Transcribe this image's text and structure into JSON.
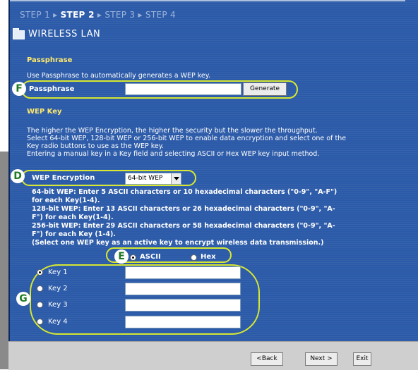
{
  "wizard": {
    "step1": "STEP 1",
    "sep1": "▸",
    "step2": "STEP 2",
    "sep2": "▸",
    "step3": "STEP 3",
    "sep3": "▸",
    "step4": "STEP 4",
    "active_step": "STEP 2"
  },
  "page": {
    "title": "WIRELESS LAN",
    "icon": "folder-icon"
  },
  "passphrase_section": {
    "title": "Passphrase",
    "description": "Use Passphrase to automatically generates a WEP key.",
    "label": "Passphrase",
    "value": "",
    "generate_label": "Generate",
    "callout": "F"
  },
  "wep_section": {
    "title": "WEP Key",
    "desc1": "The higher the WEP Encryption, the higher the security but the slower the throughput.",
    "desc2": "Select 64-bit WEP, 128-bit WEP or 256-bit WEP to enable data encryption and select one of the",
    "desc3": "Key radio buttons to use as the WEP key.",
    "desc4": "Entering a manual key in a Key field and selecting ASCII or Hex WEP key input method.",
    "encryption_label": "WEP Encryption",
    "encryption_value": "64-bit WEP",
    "callout_d": "D",
    "info1": "64-bit WEP: Enter 5 ASCII characters or 10 hexadecimal characters (\"0-9\", \"A-F\")",
    "info2": "for each Key(1-4).",
    "info3": "128-bit WEP: Enter 13 ASCII characters or 26 hexadecimal characters (\"0-9\", \"A-",
    "info4": "F\") for each Key(1-4).",
    "info5": "256-bit WEP: Enter 29 ASCII characters or 58 hexadecimal characters (\"0-9\", \"A-",
    "info6": "F\") for each Key (1-4).",
    "info7": "(Select one WEP key as an active key to encrypt wireless data transmission.)",
    "callout_e": "E",
    "ascii_label": "ASCII",
    "hex_label": "Hex",
    "input_method": "ASCII",
    "callout_g": "G",
    "keys": [
      {
        "label": "Key 1",
        "value": "",
        "selected": true
      },
      {
        "label": "Key 2",
        "value": "",
        "selected": false
      },
      {
        "label": "Key 3",
        "value": "",
        "selected": false
      },
      {
        "label": "Key 4",
        "value": "",
        "selected": false
      }
    ]
  },
  "footer": {
    "back_label": "<Back",
    "next_label": "Next >",
    "exit_label": "Exit"
  },
  "colors": {
    "background": "#2b5aa8",
    "section_title": "#ffe96b",
    "callout": "#d8e830",
    "badge_text": "#1f7a24"
  }
}
